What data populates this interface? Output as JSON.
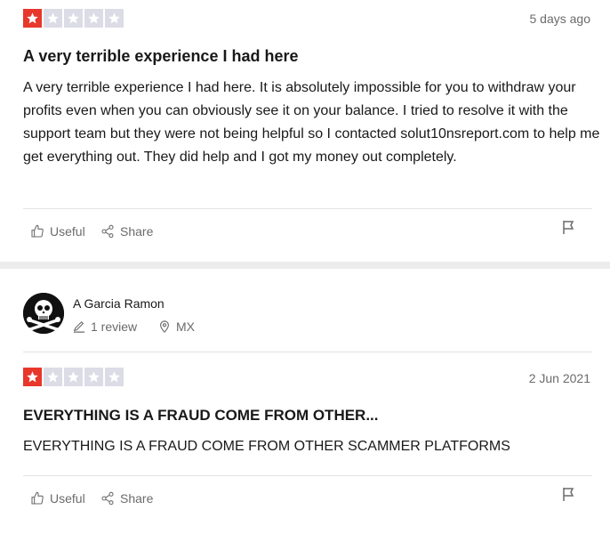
{
  "colors": {
    "star_active": "#e8372b",
    "star_inactive": "#dcdce6",
    "text_muted": "#6b6b6b"
  },
  "reviews": [
    {
      "rating": 1,
      "date": "5 days ago",
      "title": "A very terrible experience I had here",
      "text": "A very terrible experience I had here. It is absolutely impossible for you to withdraw your profits even when you can obviously see it on your balance. I tried to resolve it with the support team but they were not being helpful so I contacted solut10nsreport.com to help me get everything out. They did help and I got my money out completely.",
      "useful_label": "Useful",
      "share_label": "Share"
    },
    {
      "reviewer": {
        "name": "A Garcia Ramon",
        "reviews": "1 review",
        "country": "MX"
      },
      "rating": 1,
      "date": "2 Jun 2021",
      "title": "EVERYTHING IS A FRAUD COME FROM OTHER...",
      "text": "EVERYTHING IS A FRAUD COME FROM OTHER SCAMMER PLATFORMS",
      "useful_label": "Useful",
      "share_label": "Share"
    }
  ]
}
